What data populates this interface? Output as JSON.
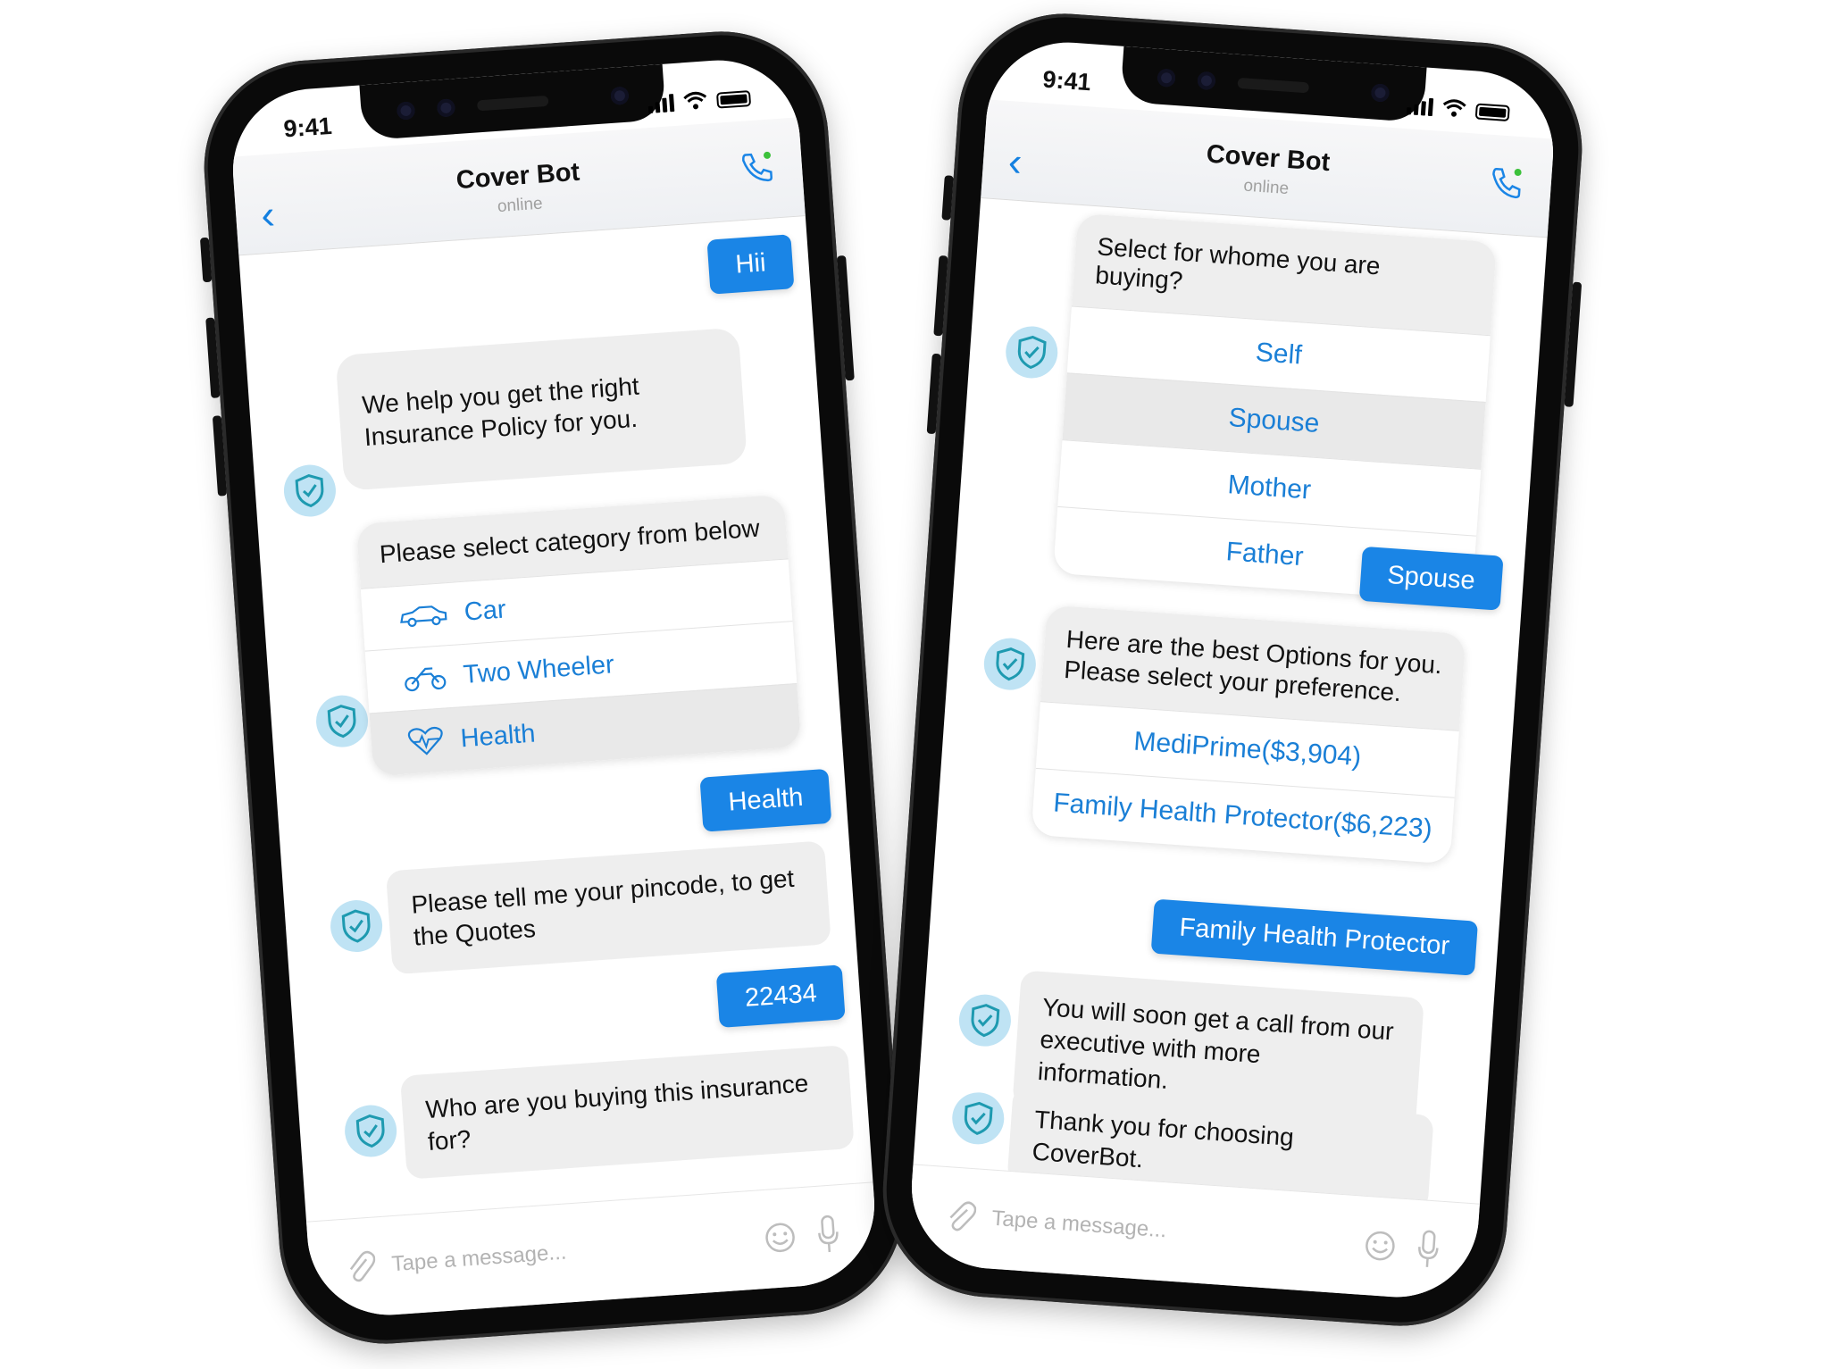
{
  "left": {
    "status": {
      "time": "9:41"
    },
    "header": {
      "title": "Cover Bot",
      "subtitle": "online"
    },
    "messages": {
      "user1": "Hii",
      "bot1": "We help you get the right Insurance Policy for you.",
      "category_prompt": "Please select category from below",
      "categories": [
        {
          "label": "Car",
          "icon": "car-icon"
        },
        {
          "label": "Two Wheeler",
          "icon": "motorcycle-icon"
        },
        {
          "label": "Health",
          "icon": "heart-pulse-icon"
        }
      ],
      "user2": "Health",
      "bot2": "Please tell me your pincode, to get the Quotes",
      "user3": "22434",
      "bot3": "Who are you buying this insurance for?"
    },
    "input": {
      "placeholder": "Tape a message..."
    }
  },
  "right": {
    "status": {
      "time": "9:41"
    },
    "header": {
      "title": "Cover Bot",
      "subtitle": "online"
    },
    "messages": {
      "whom_prompt": "Select for whome you are buying?",
      "whom_options": [
        "Self",
        "Spouse",
        "Mother",
        "Father"
      ],
      "selected_whom": "Spouse",
      "user1": "Spouse",
      "bot1": "Here are the best Options for you. Please select your preference.",
      "plans": [
        "MediPrime($3,904)",
        "Family Health Protector($6,223)"
      ],
      "user2": "Family Health Protector",
      "bot2": "You will soon get a call from our executive with more information.",
      "bot3": "Thank you for choosing CoverBot."
    },
    "input": {
      "placeholder": "Tape a message..."
    }
  },
  "colors": {
    "accent": "#1a85e6",
    "bubble": "#eeeeee",
    "avatar": "#bfe3f4",
    "shield": "#1e9ab0",
    "online_dot": "#3cc13b"
  }
}
